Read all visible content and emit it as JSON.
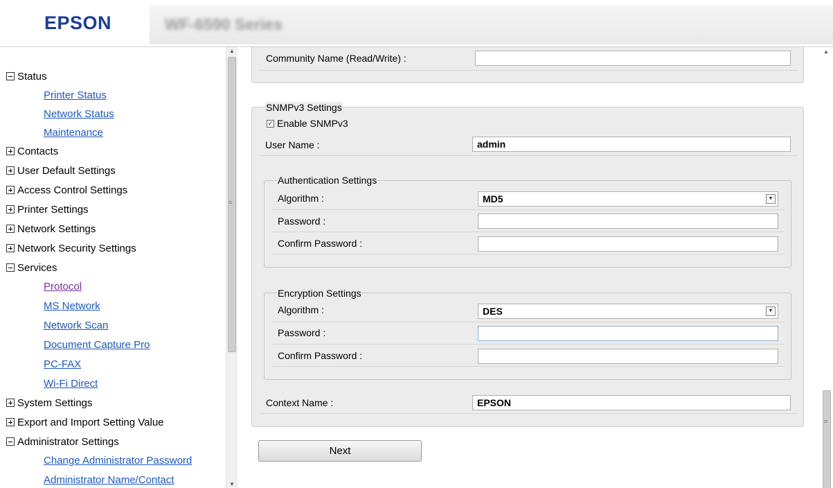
{
  "header": {
    "brand": "EPSON",
    "model": "WF-6590 Series"
  },
  "sidebar": {
    "status": "Status",
    "status_links": [
      "Printer Status",
      "Network Status",
      "Maintenance"
    ],
    "contacts": "Contacts",
    "user_default": "User Default Settings",
    "access_control": "Access Control Settings",
    "printer_settings": "Printer Settings",
    "network_settings": "Network Settings",
    "network_security": "Network Security Settings",
    "services": "Services",
    "services_links": [
      "Protocol",
      "MS Network",
      "Network Scan",
      "Document Capture Pro",
      "PC-FAX",
      "Wi-Fi Direct"
    ],
    "system_settings": "System Settings",
    "export_import": "Export and Import Setting Value",
    "admin_settings": "Administrator Settings",
    "admin_links": [
      "Change Administrator Password",
      "Administrator Name/Contact"
    ]
  },
  "content": {
    "community_label": "Community Name (Read/Write) :",
    "community_value": "",
    "snmpv3": {
      "legend": "SNMPv3 Settings",
      "enable_label": "Enable SNMPv3",
      "enable_checked": true,
      "user_label": "User Name :",
      "user_value": "admin",
      "auth": {
        "legend": "Authentication Settings",
        "algorithm_label": "Algorithm :",
        "algorithm_value": "MD5",
        "password_label": "Password :",
        "confirm_label": "Confirm Password :"
      },
      "encryption": {
        "legend": "Encryption Settings",
        "algorithm_label": "Algorithm :",
        "algorithm_value": "DES",
        "password_label": "Password :",
        "confirm_label": "Confirm Password :"
      },
      "context_label": "Context Name :",
      "context_value": "EPSON"
    },
    "next_label": "Next"
  },
  "icons": {
    "collapse": "minus-box-icon",
    "expand": "plus-box-icon",
    "scroll_up": "scroll-up-icon",
    "scroll_down": "scroll-down-icon"
  },
  "colors": {
    "brand": "#1a3e94",
    "link": "#1d58b8",
    "visited_link": "#7a2d9a"
  }
}
